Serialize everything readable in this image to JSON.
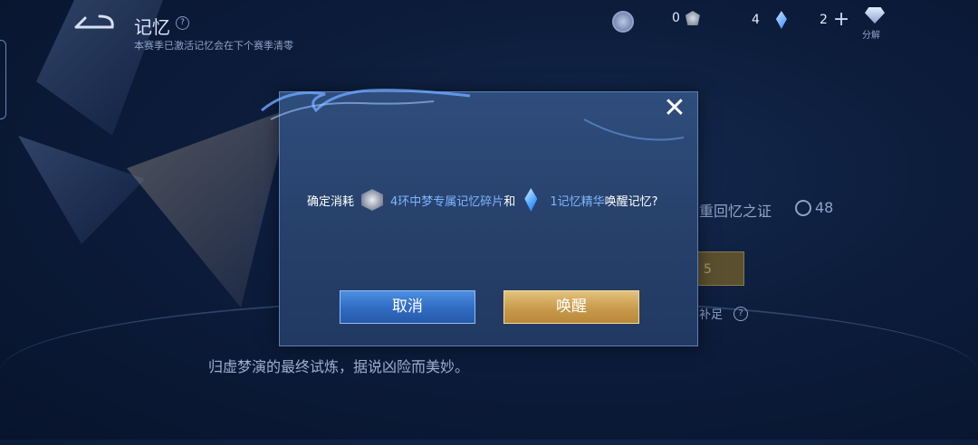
{
  "header": {
    "title": "记忆",
    "info_symbol": "?",
    "subtitle": "本赛季已激活记忆会在下个赛季清零",
    "resources": [
      {
        "icon": "coin-icon",
        "value": "0"
      },
      {
        "icon": "memory-fragment-icon",
        "value": "4"
      },
      {
        "icon": "memory-essence-icon",
        "value": "2"
      }
    ],
    "decompose_label": "分解"
  },
  "background": {
    "proof_label": "重回忆之证",
    "proof_count": "48",
    "gold_button_partial": "5",
    "insufficient_label": "补足",
    "help_symbol": "?",
    "description": "归虚梦演的最终试炼，据说凶险而美妙。"
  },
  "dialog": {
    "close_symbol": "✕",
    "confirm_prefix": "确定消耗",
    "item1_text": "4环中梦专属记忆碎片",
    "conjunction": "和",
    "item2_text": "1记忆精华",
    "confirm_suffix": "唤醒记忆?",
    "cancel_label": "取消",
    "awaken_label": "唤醒"
  },
  "colors": {
    "highlight": "#7db6ff",
    "cancel_button": "#2f6bc2",
    "awaken_button": "#c99a4c"
  }
}
